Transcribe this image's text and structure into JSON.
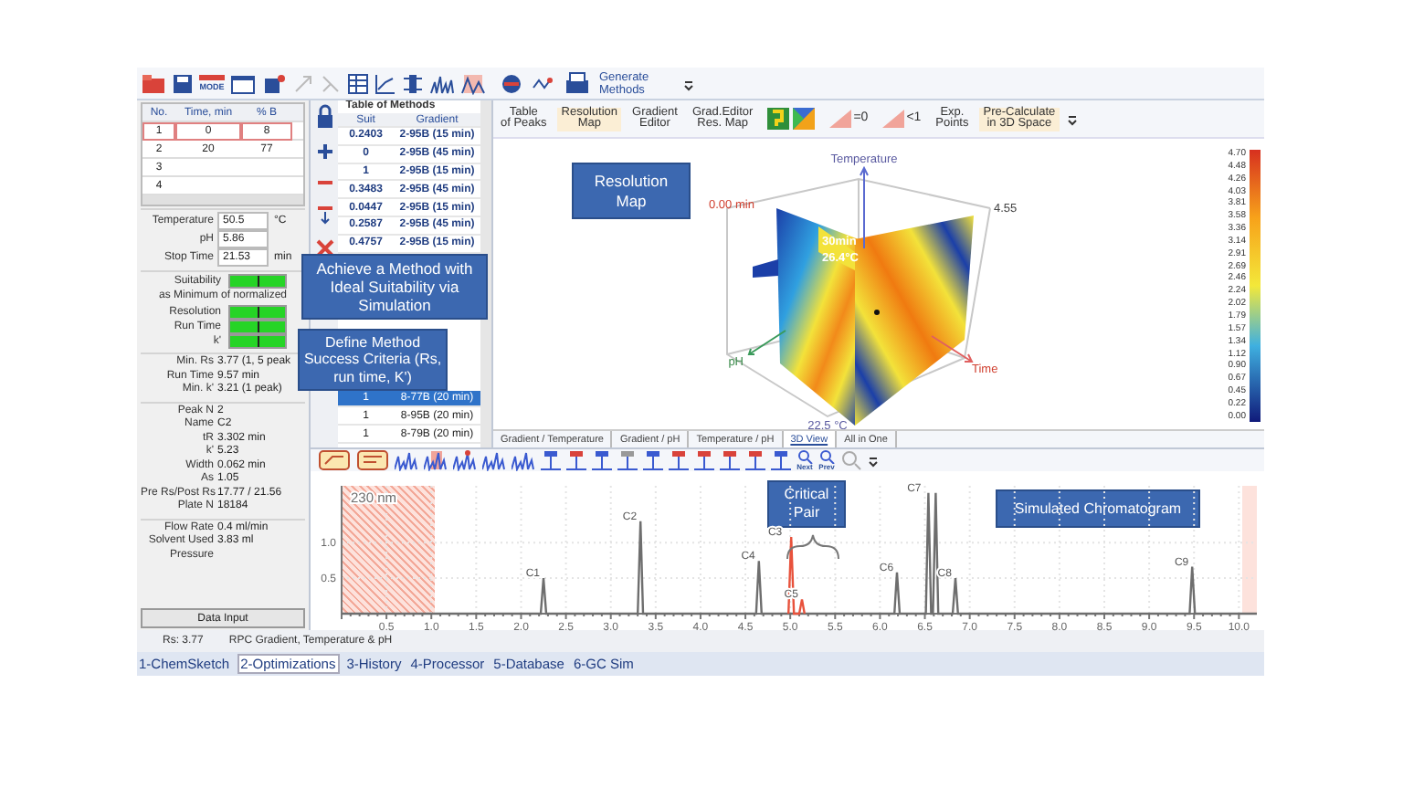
{
  "toolbar": {
    "mode_label": "MODE",
    "generate_button": "Generate Methods"
  },
  "view_toolbar": [
    {
      "kind": "text",
      "label": "Table\nof Peaks",
      "selected": false
    },
    {
      "kind": "text",
      "label": "Resolution\nMap",
      "selected": true
    },
    {
      "kind": "text",
      "label": "Gradient\nEditor",
      "selected": false
    },
    {
      "kind": "text",
      "label": "Grad.Editor\nRes. Map",
      "selected": false
    },
    {
      "kind": "icon",
      "selected": false
    },
    {
      "kind": "hatch",
      "label": "=0",
      "selected": false
    },
    {
      "kind": "hatch",
      "label": "<1",
      "selected": false
    },
    {
      "kind": "text",
      "label": "Exp.\nPoints",
      "selected": false
    },
    {
      "kind": "text",
      "label": "Pre-Calculate\nin 3D Space",
      "selected": true
    }
  ],
  "gradient_table": {
    "columns": [
      "No.",
      "Time, min",
      "% B"
    ],
    "rows": [
      {
        "cells": [
          "1",
          "0",
          "8"
        ],
        "selected": true
      },
      {
        "cells": [
          "2",
          "20",
          "77"
        ],
        "selected": false
      },
      {
        "cells": [
          "3"
        ],
        "selected": false
      },
      {
        "cells": [
          "4"
        ],
        "selected": false
      }
    ]
  },
  "conditions": [
    {
      "label": "Temperature",
      "value": "50.5",
      "unit": "°C"
    },
    {
      "label": "pH",
      "value": "5.86"
    },
    {
      "label": "Stop Time",
      "value": "21.53",
      "unit": "min"
    }
  ],
  "suitability": {
    "label": "Suitability",
    "level": 0.5,
    "note": "as Minimum of normalized"
  },
  "criteria": [
    {
      "label": "Resolution",
      "level": 0.5
    },
    {
      "label": "Run Time",
      "level": 0.5
    },
    {
      "label": "k'",
      "level": 0.5
    }
  ],
  "results": [
    {
      "label": "Min. Rs",
      "value": "3.77 (1, 5 peak"
    },
    {
      "label": "Run Time",
      "value": "9.57 min"
    },
    {
      "label": "Min. k'",
      "value": "3.21 (1 peak)"
    }
  ],
  "peak_info": [
    {
      "label": "Peak N",
      "value": "2"
    },
    {
      "label": "Name",
      "value": "C2"
    },
    {
      "label": "tR",
      "value": "3.302 min"
    },
    {
      "label": "k'",
      "value": "5.23"
    },
    {
      "label": "Width",
      "value": "0.062 min"
    },
    {
      "label": "As",
      "value": "1.05"
    },
    {
      "label": "Pre Rs/Post Rs",
      "value": "17.77 / 21.56"
    },
    {
      "label": "Plate N",
      "value": "18184"
    }
  ],
  "flow": [
    {
      "label": "Flow Rate",
      "value": "0.4 ml/min"
    },
    {
      "label": "Solvent Used",
      "value": "3.83 ml"
    },
    {
      "label": "Pressure"
    }
  ],
  "data_input_button": "Data Input",
  "methods": {
    "title": "Table of Methods",
    "columns": [
      "Suit",
      "Gradient"
    ],
    "rows": [
      {
        "suit": "0.2403",
        "gradient": "2-95B (15 min)",
        "selected": false
      },
      {
        "suit": "0",
        "gradient": "2-95B (45 min)",
        "selected": false
      },
      {
        "suit": "1",
        "gradient": "2-95B (15 min)",
        "selected": false
      },
      {
        "suit": "0.3483",
        "gradient": "2-95B (45 min)",
        "selected": false
      },
      {
        "suit": "0.0447",
        "gradient": "2-95B (15 min)",
        "selected": false
      },
      {
        "suit": "0.2587",
        "gradient": "2-95B (45 min)",
        "selected": false
      },
      {
        "suit": "0.4757",
        "gradient": "2-95B (15 min)",
        "selected": false
      }
    ],
    "rows_lower": [
      {
        "suit": "1",
        "gradient": "8-77B (20 min)",
        "selected": true
      },
      {
        "suit": "1",
        "gradient": "8-95B (20 min)",
        "selected": false
      },
      {
        "suit": "1",
        "gradient": "8-79B (20 min)",
        "selected": false
      }
    ]
  },
  "map3d": {
    "axis_labels": [
      "Temperature",
      "0.00 min",
      "4.55",
      "pH",
      "Time",
      "22.5 °C"
    ],
    "cursor_labels": [
      "30min",
      "26.4°C"
    ],
    "colorbar": [
      "4.70",
      "4.48",
      "4.26",
      "4.03",
      "3.81",
      "3.58",
      "3.36",
      "3.14",
      "2.91",
      "2.69",
      "2.46",
      "2.24",
      "2.02",
      "1.79",
      "1.57",
      "1.34",
      "1.12",
      "0.90",
      "0.67",
      "0.45",
      "0.22",
      "0.00"
    ]
  },
  "view_tabs": [
    {
      "label": "Gradient / Temperature",
      "selected": false
    },
    {
      "label": "Gradient / pH",
      "selected": false
    },
    {
      "label": "Temperature / pH",
      "selected": false
    },
    {
      "label": "3D View",
      "selected": true
    },
    {
      "label": "All in One",
      "selected": false
    }
  ],
  "chromatogram": {
    "nav_labels": [
      "Next",
      "Prev"
    ],
    "chart_data": {
      "type": "line",
      "x": [
        0,
        2.22,
        2.25,
        2.28,
        3.3,
        3.33,
        3.36,
        4.62,
        4.65,
        4.68,
        4.98,
        5.01,
        5.04,
        5.1,
        5.13,
        5.16,
        6.16,
        6.19,
        6.22,
        6.51,
        6.54,
        6.57,
        6.59,
        6.62,
        6.65,
        6.81,
        6.84,
        6.87,
        9.45,
        9.48,
        9.51,
        10.2
      ],
      "series": [
        {
          "name": "230 nm",
          "color": "#6e6e6e",
          "values": [
            0,
            0,
            0.5,
            0,
            0,
            1.3,
            0,
            0,
            0.74,
            0,
            0,
            0,
            0,
            0,
            0,
            0,
            0,
            0.58,
            0,
            0,
            1.7,
            0,
            0,
            1.7,
            0,
            0,
            0.5,
            0,
            0,
            0.66,
            0,
            0
          ]
        },
        {
          "color": "#e8523c",
          "values": [
            null,
            null,
            null,
            null,
            null,
            null,
            null,
            null,
            null,
            null,
            0,
            1.08,
            0,
            0,
            0.2,
            0,
            null,
            null,
            null,
            null,
            null,
            null,
            null,
            null,
            null,
            null,
            null,
            null,
            null,
            null,
            null,
            null
          ]
        }
      ],
      "xlim": [
        0,
        10.2
      ],
      "ylim": [
        0,
        1.8
      ],
      "grid": true,
      "xticks": [
        0.5,
        {
          "value": 1,
          "label": "1.0"
        },
        1.5,
        {
          "value": 2,
          "label": "2.0"
        },
        2.5,
        {
          "value": 3,
          "label": "3.0"
        },
        3.5,
        {
          "value": 4,
          "label": "4.0"
        },
        4.5,
        {
          "value": 5,
          "label": "5.0"
        },
        5.5,
        {
          "value": 6,
          "label": "6.0"
        },
        6.5,
        {
          "value": 7,
          "label": "7.0"
        },
        7.5,
        {
          "value": 8,
          "label": "8.0"
        },
        8.5,
        {
          "value": 9,
          "label": "9.0"
        },
        9.5,
        {
          "value": 10,
          "label": "10.0"
        }
      ],
      "yticks": [
        0.5,
        {
          "value": 1,
          "label": "1.0"
        }
      ],
      "annotations": [
        {
          "x": 2.25,
          "y": 0.5,
          "text": "C1"
        },
        {
          "x": 3.33,
          "y": 1.3,
          "text": "C2"
        },
        {
          "x": 4.65,
          "y": 0.74,
          "text": "C4"
        },
        {
          "x": 4.95,
          "y": 1.08,
          "text": "C3"
        },
        {
          "x": 5.13,
          "y": 0.2,
          "text": "C5"
        },
        {
          "x": 6.19,
          "y": 0.58,
          "text": "C6"
        },
        {
          "x": 6.5,
          "y": 1.7,
          "text": "C7"
        },
        {
          "x": 6.84,
          "y": 0.5,
          "text": "C8"
        },
        {
          "x": 9.48,
          "y": 0.66,
          "text": "C9"
        }
      ]
    }
  },
  "callouts": [
    {
      "text": "Achieve a Method with Ideal Suitability via Simulation"
    },
    {
      "text": "Define Method Success Criteria (Rs, run time, K')"
    },
    {
      "text": "Resolution Map"
    },
    {
      "text": "Critical Pair"
    },
    {
      "text": "Simulated Chromatogram"
    }
  ],
  "status": {
    "rs": "Rs: 3.77",
    "mode": "RPC Gradient, Temperature & pH"
  },
  "bottom_tabs": [
    {
      "label": "1-ChemSketch",
      "selected": false
    },
    {
      "label": "2-Optimizations",
      "selected": true
    },
    {
      "label": "3-History",
      "selected": false
    },
    {
      "label": "4-Processor",
      "selected": false
    },
    {
      "label": "5-Database",
      "selected": false
    },
    {
      "label": "6-GC Sim",
      "selected": false
    }
  ]
}
